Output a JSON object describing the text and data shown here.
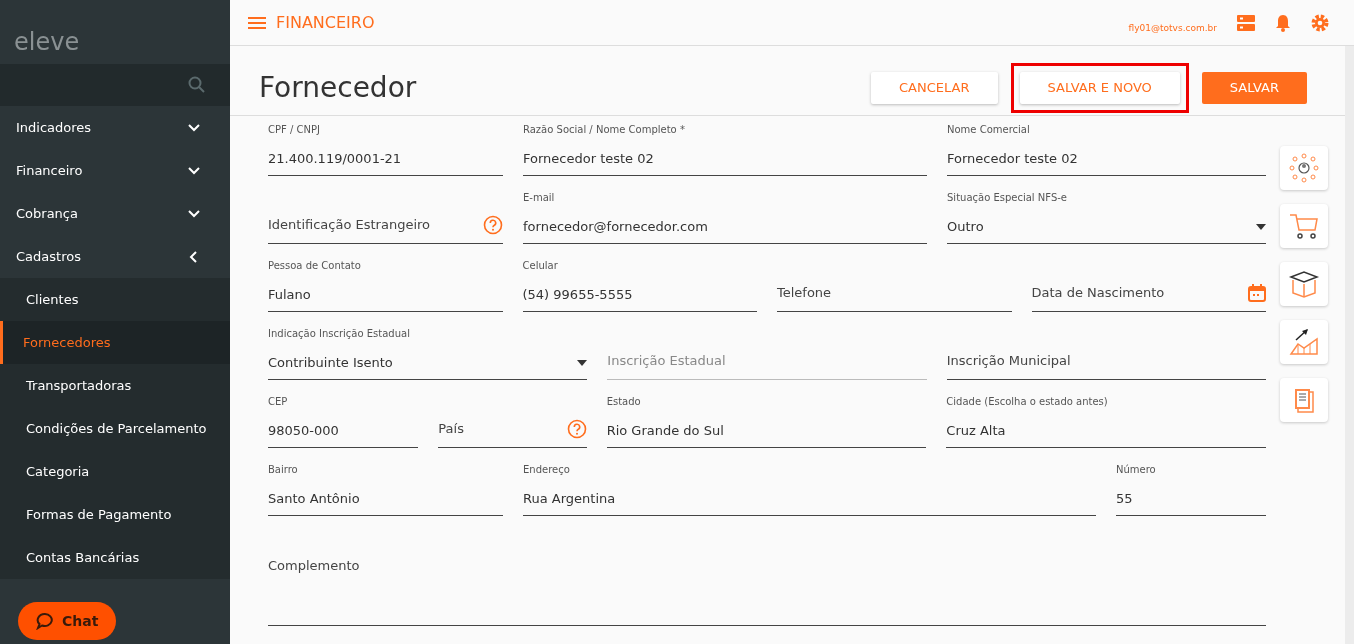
{
  "sidebar": {
    "logo": "eleve",
    "items": [
      {
        "label": "Indicadores",
        "expanded": false
      },
      {
        "label": "Financeiro",
        "expanded": false
      },
      {
        "label": "Cobrança",
        "expanded": false
      },
      {
        "label": "Cadastros",
        "expanded": true,
        "children": [
          {
            "label": "Clientes",
            "selected": false
          },
          {
            "label": "Fornecedores",
            "selected": true
          },
          {
            "label": "Transportadoras",
            "selected": false
          },
          {
            "label": "Condições de Parcelamento",
            "selected": false
          },
          {
            "label": "Categoria",
            "selected": false
          },
          {
            "label": "Formas de Pagamento",
            "selected": false
          },
          {
            "label": "Contas Bancárias",
            "selected": false
          }
        ]
      }
    ]
  },
  "chat": {
    "label": "Chat"
  },
  "topbar": {
    "module": "FINANCEIRO",
    "user": "fly01@totvs.com.br"
  },
  "page": {
    "title": "Fornecedor",
    "buttons": [
      {
        "label": "CANCELAR",
        "kind": "outline",
        "highlighted": false
      },
      {
        "label": "SALVAR E NOVO",
        "kind": "outline",
        "highlighted": true
      },
      {
        "label": "SALVAR",
        "kind": "primary",
        "highlighted": false
      }
    ]
  },
  "form": {
    "rows": [
      {
        "fields": [
          {
            "label": "CPF / CNPJ",
            "value": "21.400.119/0001-21",
            "kind": "text"
          },
          {
            "label": "Razão Social / Nome Completo *",
            "value": "Fornecedor teste 02",
            "kind": "text"
          },
          {
            "label": "Nome Comercial",
            "value": "Fornecedor teste 02",
            "kind": "text"
          }
        ]
      },
      {
        "fields": [
          {
            "placeholder": "Identificação Estrangeiro",
            "kind": "help"
          },
          {
            "label": "E-mail",
            "value": "fornecedor@fornecedor.com",
            "kind": "text"
          },
          {
            "label": "Situação Especial NFS-e",
            "value": "Outro",
            "kind": "select"
          }
        ]
      },
      {
        "fields": [
          {
            "label": "Pessoa de Contato",
            "value": "Fulano",
            "kind": "text"
          },
          {
            "label": "Celular",
            "value": "(54) 99655-5555",
            "kind": "text"
          },
          {
            "placeholder": "Telefone",
            "kind": "text"
          },
          {
            "placeholder": "Data de Nascimento",
            "kind": "date"
          }
        ]
      },
      {
        "fields": [
          {
            "label": "Indicação Inscrição Estadual",
            "value": "Contribuinte Isento",
            "kind": "select"
          },
          {
            "placeholder": "Inscrição Estadual",
            "kind": "text",
            "disabled": true
          },
          {
            "placeholder": "Inscrição Municipal",
            "kind": "text"
          }
        ]
      },
      {
        "fields": [
          {
            "label": "CEP",
            "value": "98050-000",
            "kind": "text"
          },
          {
            "placeholder": "País",
            "kind": "help"
          },
          {
            "label": "Estado",
            "value": "Rio Grande do Sul",
            "kind": "text"
          },
          {
            "label": "Cidade (Escolha o estado antes)",
            "value": "Cruz Alta",
            "kind": "text"
          }
        ]
      },
      {
        "fields": [
          {
            "label": "Bairro",
            "value": "Santo Antônio",
            "kind": "text"
          },
          {
            "label": "Endereço",
            "value": "Rua Argentina",
            "kind": "text"
          },
          {
            "label": "Número",
            "value": "55",
            "kind": "text"
          }
        ]
      },
      {
        "fields": [
          {
            "placeholder": "Complemento",
            "kind": "textarea"
          }
        ]
      }
    ]
  },
  "side_tools": [
    {
      "kind": "network"
    },
    {
      "kind": "cart"
    },
    {
      "kind": "box"
    },
    {
      "kind": "growth"
    },
    {
      "kind": "documents"
    }
  ]
}
